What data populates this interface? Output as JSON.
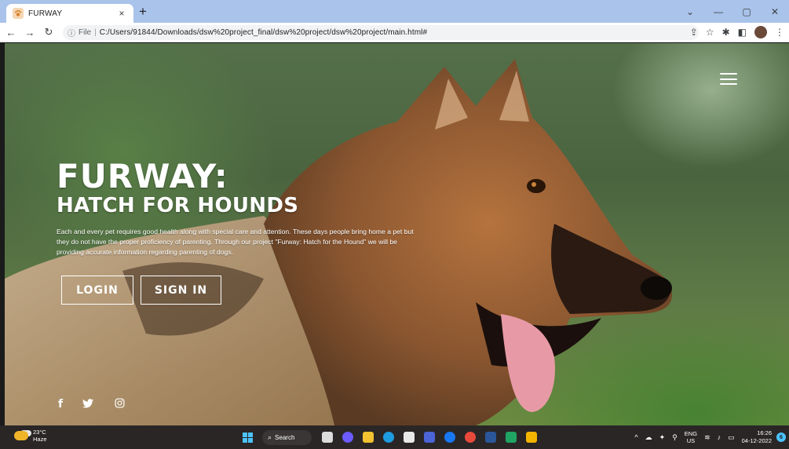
{
  "browser": {
    "tab_title": "FURWAY",
    "tab_close": "×",
    "new_tab": "+",
    "omnibox": {
      "file_label": "File",
      "separator": "|",
      "url": "C:/Users/91844/Downloads/dsw%20project_final/dsw%20project/dsw%20project/main.html#"
    }
  },
  "page": {
    "title": "FURWAY:",
    "subtitle": "HATCH FOR HOUNDS",
    "description": "Each and every pet requires good health along with special care and attention. These days people bring home a pet but they do not have the proper proficiency of parenting. Through our project \"Furway: Hatch for the Hound\" we will be providing accurate information regarding parenting of dogs.",
    "buttons": {
      "login": "LOGIN",
      "signin": "SIGN IN"
    },
    "social_icons": [
      "facebook-icon",
      "twitter-icon",
      "instagram-icon"
    ]
  },
  "taskbar": {
    "weather": {
      "temp": "23°C",
      "condition": "Haze"
    },
    "search_label": "Search",
    "language": {
      "line1": "ENG",
      "line2": "US"
    },
    "clock": {
      "time": "16:26",
      "date": "04-12-2022"
    },
    "notification_count": "6"
  },
  "colors": {
    "tabbar": "#a9c3ea",
    "taskbar": "#2a2626",
    "windows_accent": "#4cc2ff"
  }
}
